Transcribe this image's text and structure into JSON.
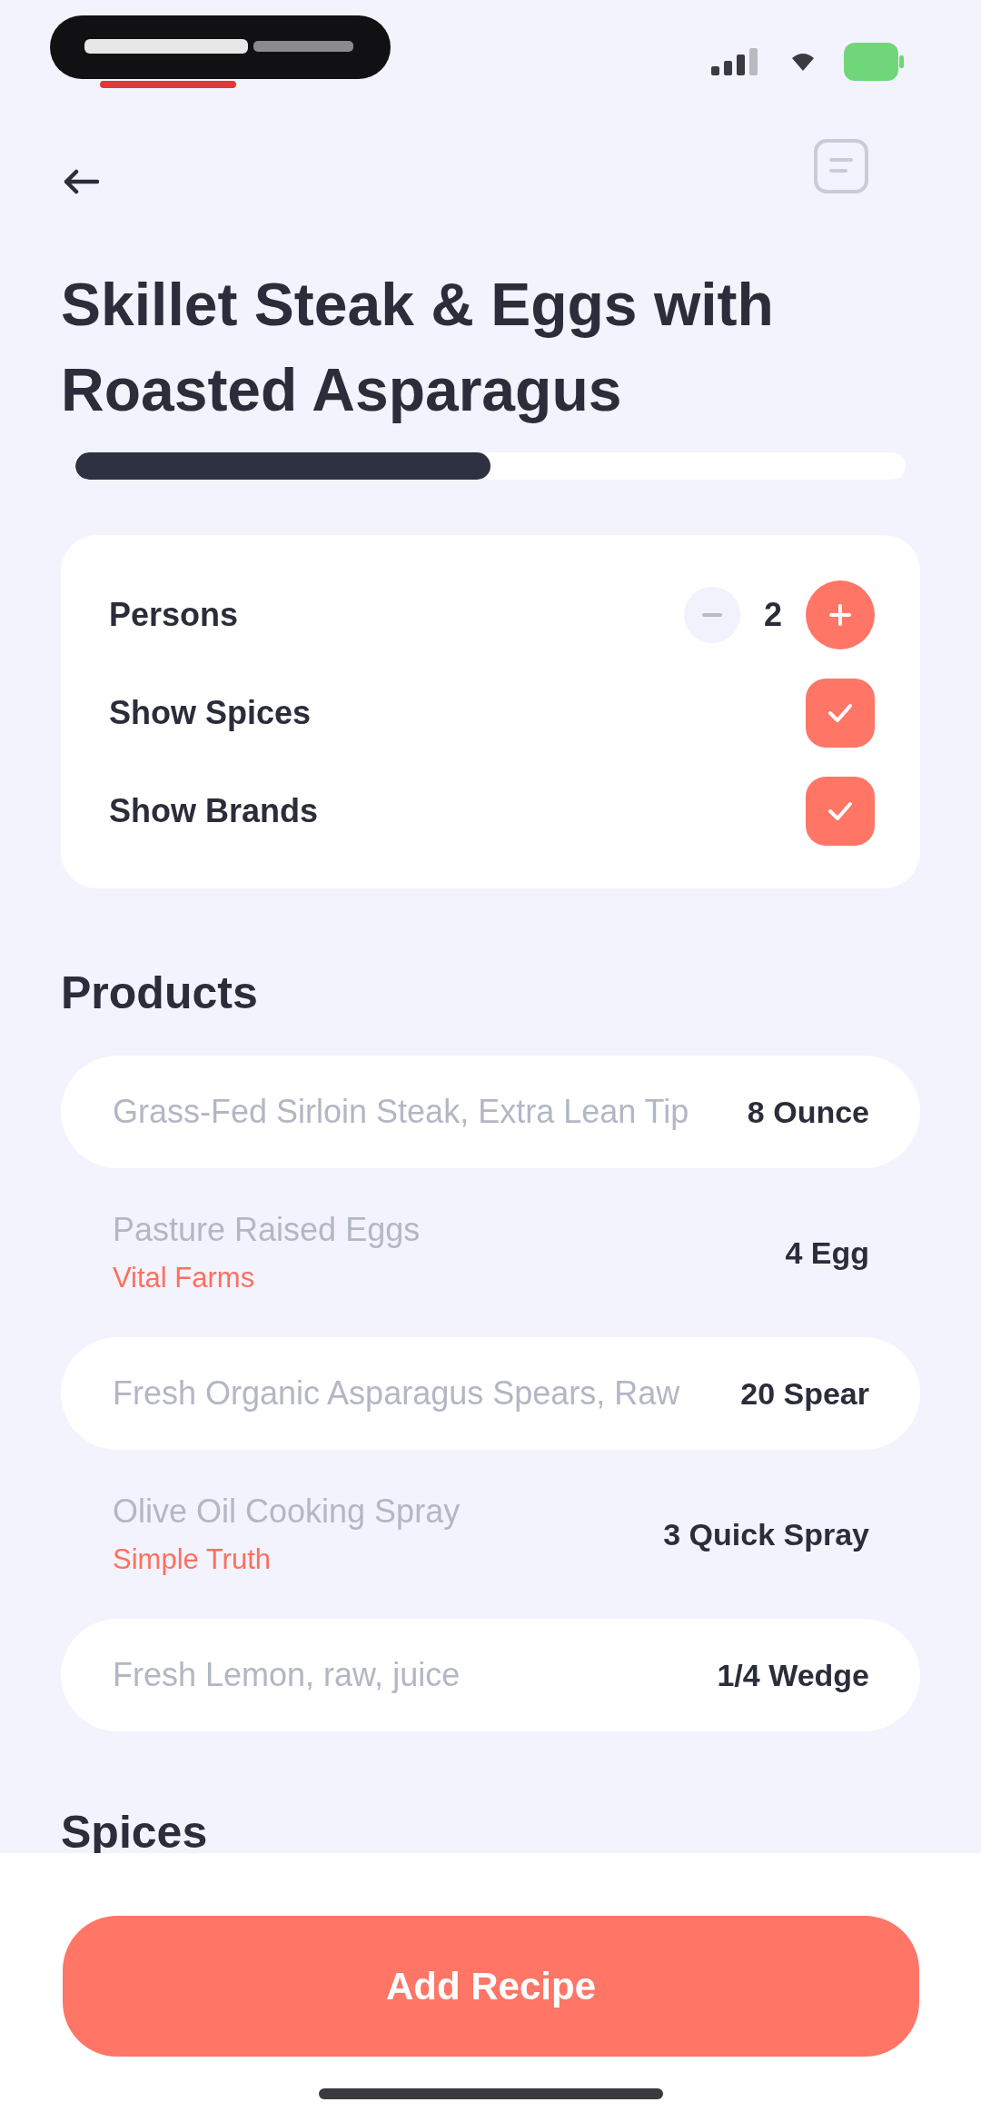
{
  "header": {
    "title": "Skillet Steak & Eggs with Roasted Asparagus"
  },
  "progress": {
    "level": 0.5
  },
  "options": [
    {
      "kind": "stepper",
      "label": "Persons",
      "value": "2"
    },
    {
      "kind": "checkbox",
      "label": "Show Spices",
      "checked": true
    },
    {
      "kind": "checkbox",
      "label": "Show Brands",
      "checked": true
    }
  ],
  "products": {
    "heading": "Products",
    "items": [
      {
        "name": "Grass-Fed Sirloin Steak, Extra Lean Tip",
        "amount": "8 Ounce"
      },
      {
        "name": "Pasture Raised Eggs",
        "brand": "Vital Farms",
        "amount": "4 Egg"
      },
      {
        "name": "Fresh Organic Asparagus Spears, Raw",
        "amount": "20 Spear"
      },
      {
        "name": "Olive Oil Cooking Spray",
        "brand": "Simple Truth",
        "amount": "3 Quick Spray"
      },
      {
        "name": "Fresh Lemon, raw, juice",
        "amount": "1/4 Wedge"
      }
    ]
  },
  "spices": {
    "heading": "Spices"
  },
  "footer": {
    "button": "Add Recipe"
  }
}
